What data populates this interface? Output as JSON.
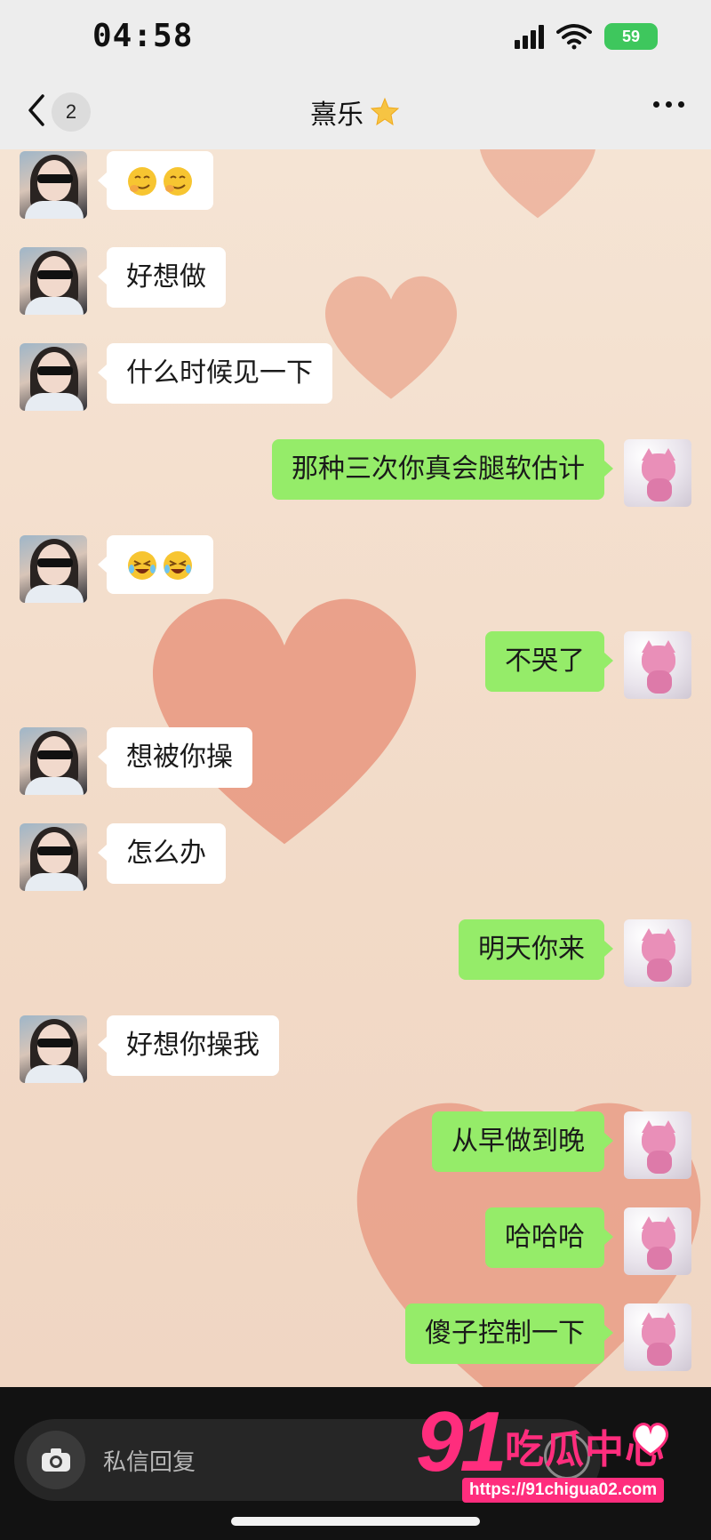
{
  "status_bar": {
    "time": "04:58",
    "battery": "59"
  },
  "nav": {
    "back_count": "2",
    "title": "熹乐",
    "title_icon": "star-icon"
  },
  "messages": [
    {
      "side": "left",
      "type": "emoji",
      "emoji": [
        "smirk-face-emoji",
        "smirk-face-emoji"
      ]
    },
    {
      "side": "left",
      "type": "text",
      "text": "好想做"
    },
    {
      "side": "left",
      "type": "text",
      "text": "什么时候见一下"
    },
    {
      "side": "right",
      "type": "text",
      "text": "那种三次你真会腿软估计"
    },
    {
      "side": "left",
      "type": "emoji",
      "emoji": [
        "laugh-cry-emoji",
        "laugh-cry-emoji"
      ]
    },
    {
      "side": "right",
      "type": "text",
      "text": "不哭了"
    },
    {
      "side": "left",
      "type": "text",
      "text": "想被你操"
    },
    {
      "side": "left",
      "type": "text",
      "text": "怎么办"
    },
    {
      "side": "right",
      "type": "text",
      "text": "明天你来"
    },
    {
      "side": "left",
      "type": "text",
      "text": "好想你操我"
    },
    {
      "side": "right",
      "type": "text",
      "text": "从早做到晚"
    },
    {
      "side": "right",
      "type": "text",
      "text": "哈哈哈"
    },
    {
      "side": "right",
      "type": "text",
      "text": "傻子控制一下"
    }
  ],
  "input": {
    "placeholder": "私信回复"
  },
  "watermark": {
    "logo": "91",
    "name": "吃瓜中心",
    "url": "https://91chigua02.com"
  },
  "colors": {
    "sent_bubble": "#95ec69",
    "received_bubble": "#ffffff",
    "watermark": "#ff2d7d"
  }
}
